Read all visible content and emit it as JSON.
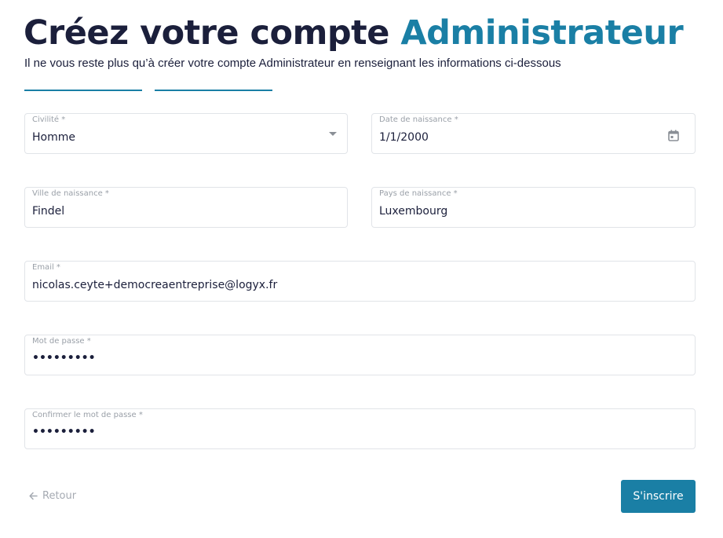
{
  "header": {
    "title_main": "Créez votre compte",
    "title_accent": "Administrateur",
    "subtitle": "Il ne vous reste plus qu’à créer votre compte Administrateur en renseignant les informations ci-dessous"
  },
  "form": {
    "civilite": {
      "label": "Civilité *",
      "value": "Homme"
    },
    "date_naissance": {
      "label": "Date de naissance *",
      "value": "1/1/2000"
    },
    "ville_naissance": {
      "label": "Ville de naissance *",
      "value": "Findel"
    },
    "pays_naissance": {
      "label": "Pays de naissance *",
      "value": "Luxembourg"
    },
    "email": {
      "label": "Email *",
      "value": "nicolas.ceyte+democreaentreprise@logyx.fr"
    },
    "mot_de_passe": {
      "label": "Mot de passe *",
      "value": "•••••••••"
    },
    "confirmer_mot_de_passe": {
      "label": "Confirmer le mot de passe *",
      "value": "•••••••••"
    }
  },
  "actions": {
    "back_label": "Retour",
    "submit_label": "S'inscrire"
  },
  "icons": {
    "select": "chevron-down-icon",
    "date": "calendar-icon",
    "back": "arrow-left-icon"
  },
  "colors": {
    "accent": "#1a7fa5",
    "title": "#1b1f3b",
    "muted": "#9aa0a8"
  }
}
